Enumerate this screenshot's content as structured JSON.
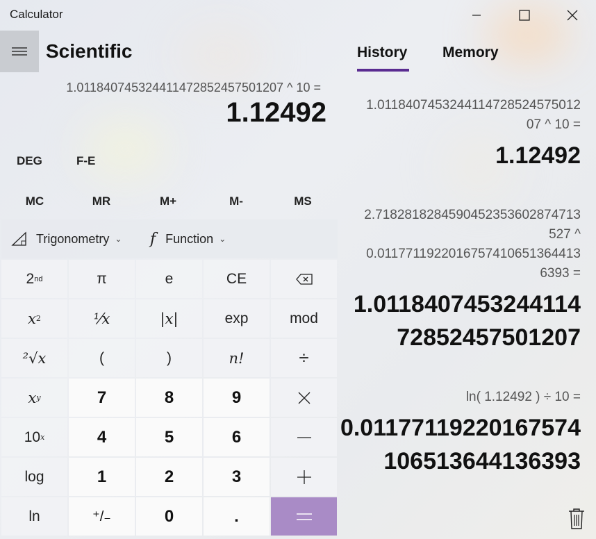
{
  "window": {
    "title": "Calculator",
    "controls": [
      "minimize",
      "maximize",
      "close"
    ]
  },
  "header": {
    "mode_title": "Scientific"
  },
  "display": {
    "expression": "1.0118407453244114728524575012 07 ^ 10 =",
    "expression_compact": "1.0118407453244114728524575012​07 ^ 10 =",
    "value": "1.12492"
  },
  "modes": {
    "angle": "DEG",
    "fe": "F-E"
  },
  "memory_buttons": [
    "MC",
    "MR",
    "M+",
    "M-",
    "MS"
  ],
  "function_bar": {
    "trig_label": "Trigonometry",
    "func_label": "Function"
  },
  "keys": {
    "row1": [
      "2nd",
      "π",
      "e",
      "CE",
      "backspace"
    ],
    "row2": [
      "x²",
      "¹⁄x",
      "|x|",
      "exp",
      "mod"
    ],
    "row3": [
      "²√x",
      "(",
      ")",
      "n!",
      "÷"
    ],
    "row4": [
      "xʸ",
      "7",
      "8",
      "9",
      "×"
    ],
    "row5": [
      "10ˣ",
      "4",
      "5",
      "6",
      "−"
    ],
    "row6": [
      "log",
      "1",
      "2",
      "3",
      "+"
    ],
    "row7": [
      "ln",
      "+/−",
      "0",
      ".",
      "="
    ]
  },
  "key_labels": {
    "two_nd_base": "2",
    "two_nd_sup": "nd",
    "pi": "π",
    "e": "e",
    "ce": "CE",
    "x_sq": "x",
    "x_sq_sup": "2",
    "reciprocal": "⅟x",
    "abs": "|x|",
    "exp": "exp",
    "mod": "mod",
    "sqrt": "²√x",
    "lparen": "(",
    "rparen": ")",
    "fact": "n!",
    "divide": "÷",
    "x_pow": "x",
    "x_pow_sup": "y",
    "seven": "7",
    "eight": "8",
    "nine": "9",
    "times": "×",
    "ten_pow": "10",
    "ten_pow_sup": "x",
    "four": "4",
    "five": "5",
    "six": "6",
    "minus": "—",
    "log": "log",
    "one": "1",
    "two": "2",
    "three": "3",
    "plus": "+",
    "ln": "ln",
    "negate": "⁺/₋",
    "zero": "0",
    "dot": ".",
    "equals": "="
  },
  "history_tabs": {
    "history": "History",
    "memory": "Memory"
  },
  "history": [
    {
      "expr_lines": [
        "1.0118407453244114728524575012",
        "07   ^   10 ="
      ],
      "result_lines": [
        "1.12492"
      ]
    },
    {
      "expr_lines": [
        "2.7182818284590452353602874713",
        "527   ^",
        "0.0117711922016757410651364413",
        "6393 ="
      ],
      "result_lines": [
        "1.0118407453244114",
        "72852457501207"
      ]
    },
    {
      "expr_lines": [
        "ln( 1.12492 )   ÷   10 ="
      ],
      "result_lines": [
        "0.0117711922016757​4",
        "106513644136393"
      ]
    }
  ],
  "colors": {
    "accent": "#5a2c91",
    "equals_bg": "#a98bc6",
    "number_key_bg": "#fafafa"
  }
}
